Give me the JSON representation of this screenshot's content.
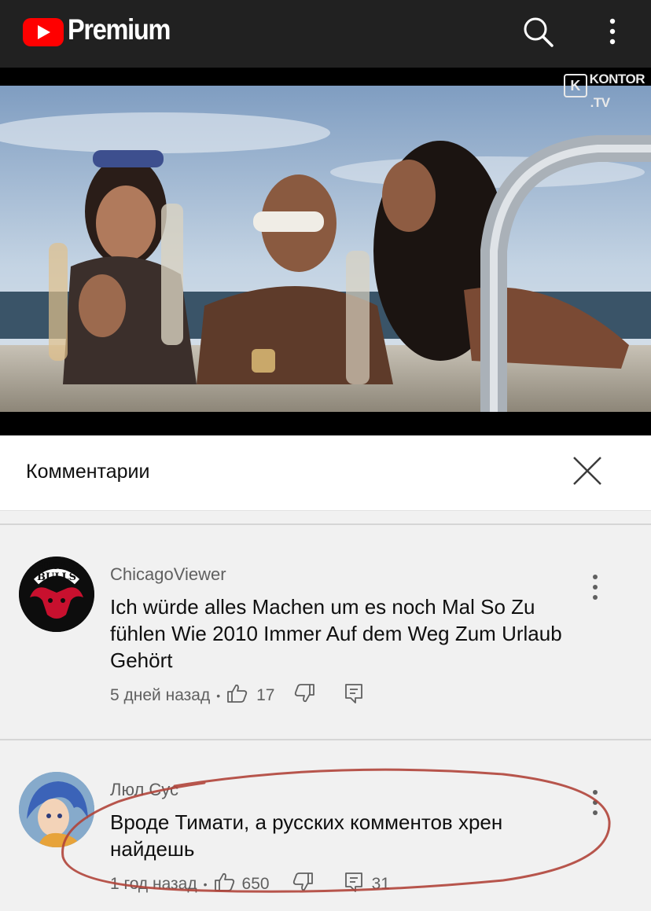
{
  "topbar": {
    "brand": "Premium",
    "logo_icon": "youtube-play-icon",
    "search_icon": "search-icon",
    "more_icon": "more-vertical-icon"
  },
  "video": {
    "watermark_k": "K",
    "watermark_text": "KONTOR",
    "watermark_sub": ".TV"
  },
  "comments_panel": {
    "title": "Комментарии",
    "close_icon": "close-icon"
  },
  "comments": [
    {
      "author": "ChicagoViewer",
      "avatar_text": "CHICAGO BULLS",
      "text": "Ich würde alles Machen um es noch Mal So Zu fühlen Wie 2010 Immer Auf dem Weg Zum Urlaub Gehört",
      "time": "5 дней назад",
      "likes": "17"
    },
    {
      "author": "Люл Сус",
      "text": "Вроде Тимати, а русских комментов хрен найдешь",
      "time": "1 год назад",
      "likes": "650",
      "replies": "31"
    }
  ],
  "colors": {
    "topbar": "#212121",
    "brand_red": "#ff0000",
    "annotation": "#b0443a"
  }
}
